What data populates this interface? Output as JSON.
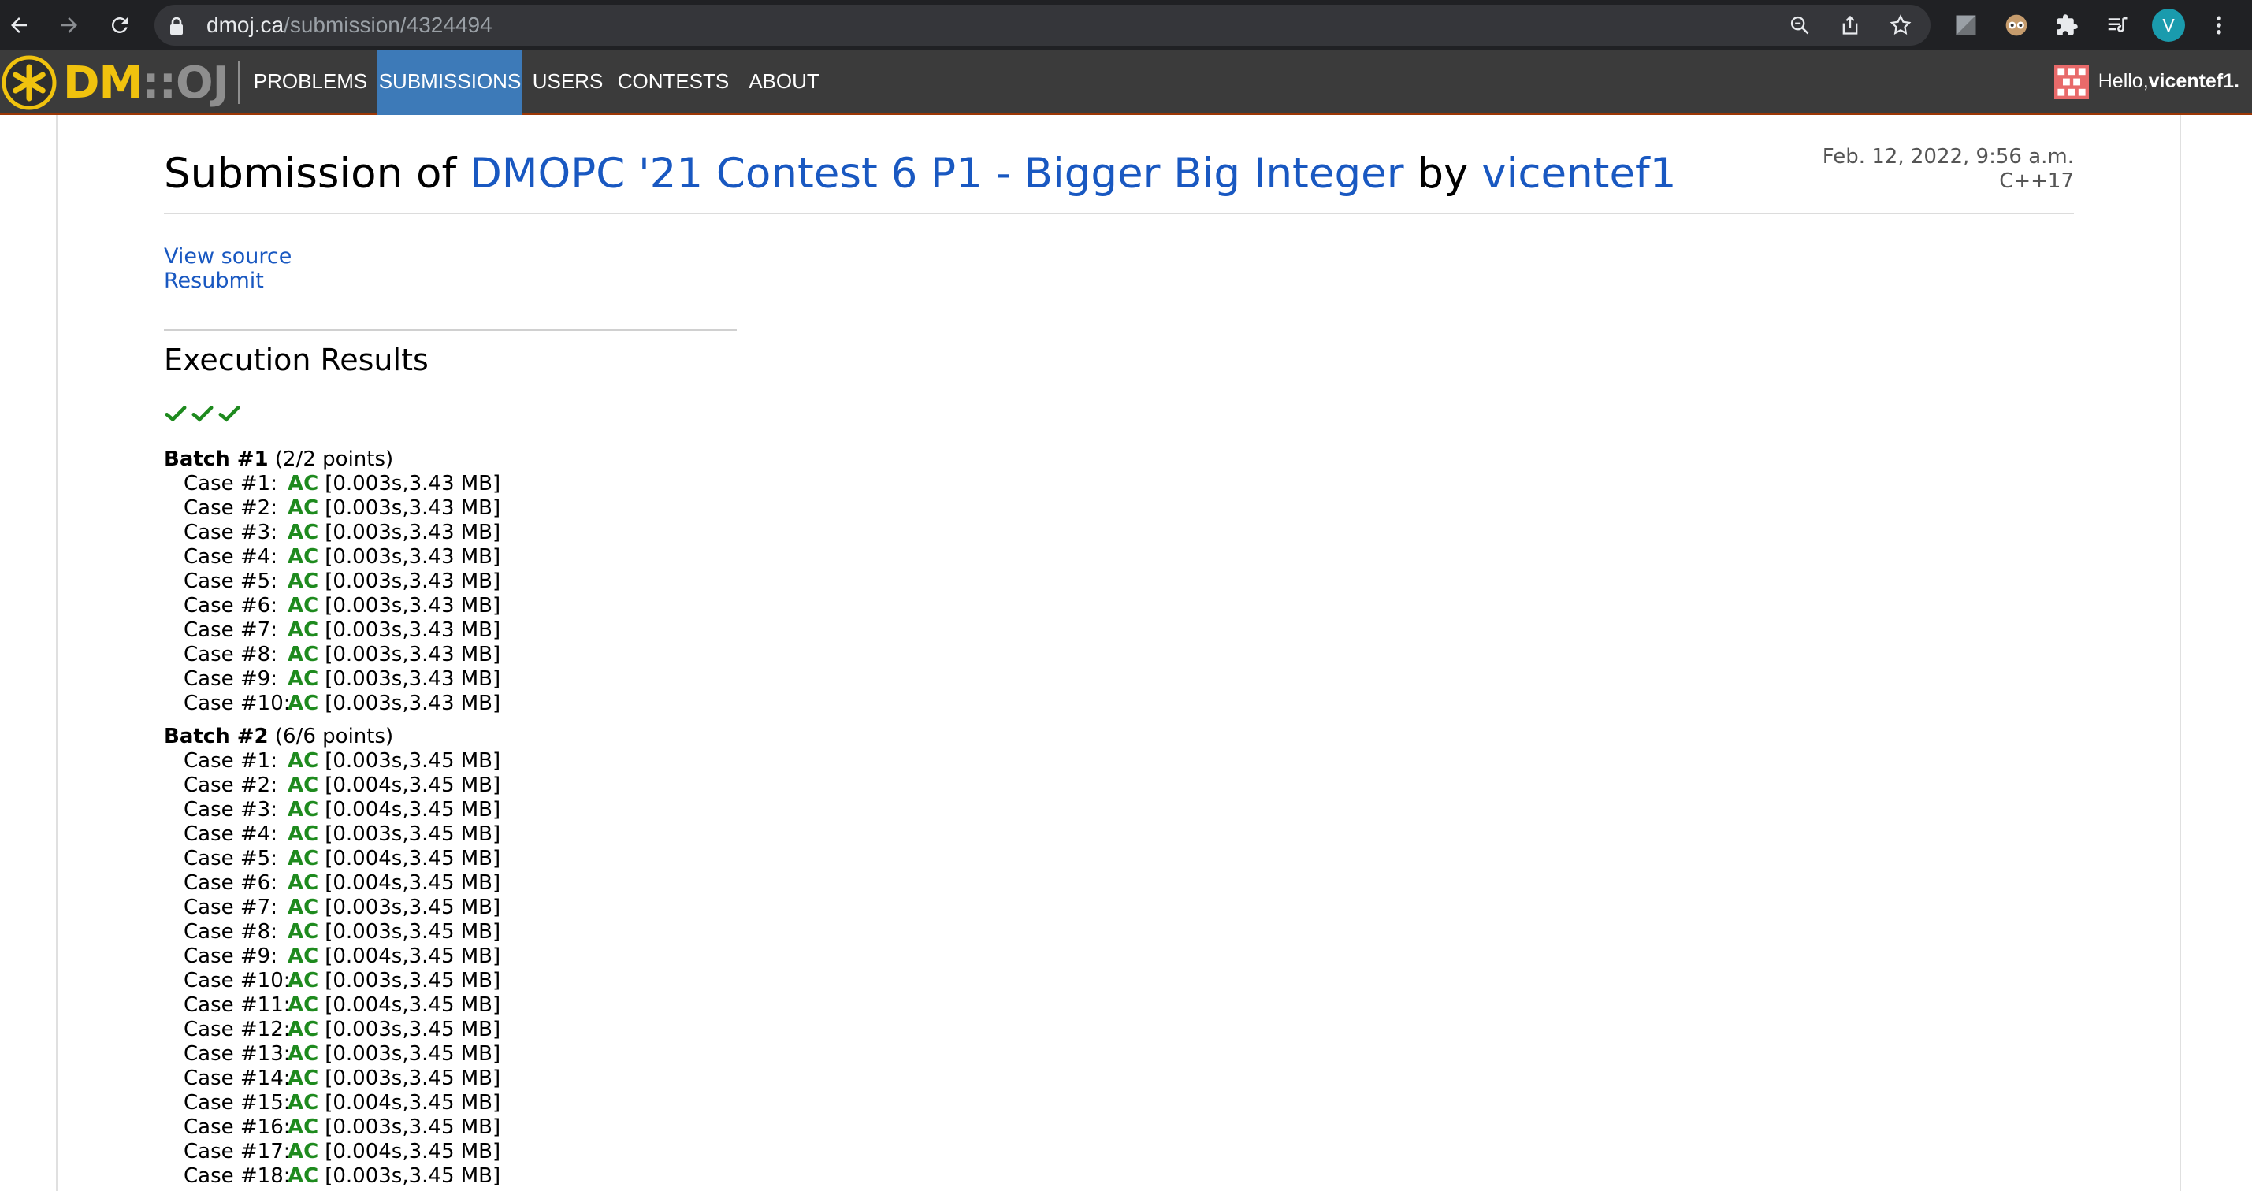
{
  "browser": {
    "url_host": "dmoj.ca",
    "url_path": "/submission/4324494",
    "profile_initial": "V"
  },
  "site": {
    "logo_dm": "DM",
    "logo_sep": "::",
    "logo_oj": "OJ",
    "nav": [
      "PROBLEMS",
      "SUBMISSIONS",
      "USERS",
      "CONTESTS",
      "ABOUT"
    ],
    "active_nav": "SUBMISSIONS",
    "greeting": "Hello, ",
    "username": "vicentef1.",
    "colors": {
      "nav_bg": "#3b3b3b",
      "accent": "#9c3706",
      "active": "#3d7ab8",
      "link": "#1958c1",
      "ac": "#1e8a1e",
      "logo": "#f0c20e"
    }
  },
  "submission": {
    "title_prefix": "Submission of",
    "problem": "DMOPC '21 Contest 6 P1 - Bigger Big Integer",
    "by": "by",
    "user": "vicentef1",
    "date": "Feb. 12, 2022, 9:56 a.m.",
    "language": "C++17",
    "view_source": "View source",
    "resubmit": "Resubmit"
  },
  "execution": {
    "heading": "Execution Results",
    "check_count": 3,
    "batches": [
      {
        "name": "Batch #1",
        "points": "(2/2 points)",
        "cases": [
          {
            "label": "Case #1:",
            "status": "AC",
            "detail": "[0.003s,3.43 MB]"
          },
          {
            "label": "Case #2:",
            "status": "AC",
            "detail": "[0.003s,3.43 MB]"
          },
          {
            "label": "Case #3:",
            "status": "AC",
            "detail": "[0.003s,3.43 MB]"
          },
          {
            "label": "Case #4:",
            "status": "AC",
            "detail": "[0.003s,3.43 MB]"
          },
          {
            "label": "Case #5:",
            "status": "AC",
            "detail": "[0.003s,3.43 MB]"
          },
          {
            "label": "Case #6:",
            "status": "AC",
            "detail": "[0.003s,3.43 MB]"
          },
          {
            "label": "Case #7:",
            "status": "AC",
            "detail": "[0.003s,3.43 MB]"
          },
          {
            "label": "Case #8:",
            "status": "AC",
            "detail": "[0.003s,3.43 MB]"
          },
          {
            "label": "Case #9:",
            "status": "AC",
            "detail": "[0.003s,3.43 MB]"
          },
          {
            "label": "Case #10:",
            "status": "AC",
            "detail": "[0.003s,3.43 MB]"
          }
        ]
      },
      {
        "name": "Batch #2",
        "points": "(6/6 points)",
        "cases": [
          {
            "label": "Case #1:",
            "status": "AC",
            "detail": "[0.003s,3.45 MB]"
          },
          {
            "label": "Case #2:",
            "status": "AC",
            "detail": "[0.004s,3.45 MB]"
          },
          {
            "label": "Case #3:",
            "status": "AC",
            "detail": "[0.004s,3.45 MB]"
          },
          {
            "label": "Case #4:",
            "status": "AC",
            "detail": "[0.003s,3.45 MB]"
          },
          {
            "label": "Case #5:",
            "status": "AC",
            "detail": "[0.004s,3.45 MB]"
          },
          {
            "label": "Case #6:",
            "status": "AC",
            "detail": "[0.004s,3.45 MB]"
          },
          {
            "label": "Case #7:",
            "status": "AC",
            "detail": "[0.003s,3.45 MB]"
          },
          {
            "label": "Case #8:",
            "status": "AC",
            "detail": "[0.003s,3.45 MB]"
          },
          {
            "label": "Case #9:",
            "status": "AC",
            "detail": "[0.004s,3.45 MB]"
          },
          {
            "label": "Case #10:",
            "status": "AC",
            "detail": "[0.003s,3.45 MB]"
          },
          {
            "label": "Case #11:",
            "status": "AC",
            "detail": "[0.004s,3.45 MB]"
          },
          {
            "label": "Case #12:",
            "status": "AC",
            "detail": "[0.003s,3.45 MB]"
          },
          {
            "label": "Case #13:",
            "status": "AC",
            "detail": "[0.003s,3.45 MB]"
          },
          {
            "label": "Case #14:",
            "status": "AC",
            "detail": "[0.003s,3.45 MB]"
          },
          {
            "label": "Case #15:",
            "status": "AC",
            "detail": "[0.004s,3.45 MB]"
          },
          {
            "label": "Case #16:",
            "status": "AC",
            "detail": "[0.003s,3.45 MB]"
          },
          {
            "label": "Case #17:",
            "status": "AC",
            "detail": "[0.004s,3.45 MB]"
          },
          {
            "label": "Case #18:",
            "status": "AC",
            "detail": "[0.003s,3.45 MB]"
          }
        ]
      }
    ]
  },
  "icons": [
    "back-arrow-icon",
    "forward-arrow-icon",
    "reload-icon",
    "lock-icon",
    "zoom-icon",
    "share-icon",
    "bookmark-star-icon",
    "extension-icon",
    "puzzle-icon",
    "reading-list-icon",
    "kebab-menu-icon",
    "check-icon"
  ]
}
